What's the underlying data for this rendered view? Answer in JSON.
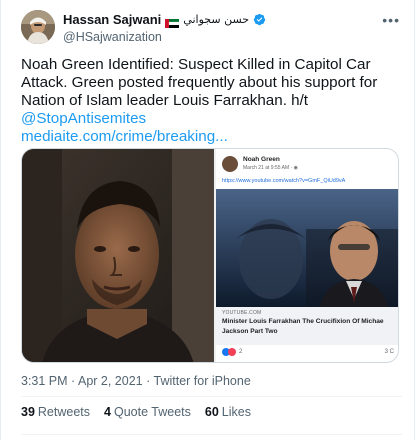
{
  "author": {
    "display_name": "Hassan Sajwani",
    "arabic_name": "حسن سجواني",
    "handle": "@HSajwanization",
    "avatar_icon": "profile-photo",
    "flag_icon": "uae-flag-icon",
    "verified_icon": "verified-badge-icon",
    "verified_color": "#1d9bf0"
  },
  "menu_icon": "more-options-icon",
  "tweet": {
    "text": "Noah Green Identified: Suspect Killed in Capitol Car Attack. Green posted frequently about his support for Nation of Islam leader Louis Farrakhan. h/t",
    "mention": "@StopAntisemites",
    "link": "mediaite.com/crime/breaking..."
  },
  "media": {
    "fb_post": {
      "name": "Noah Green",
      "date": "March 21 at 9:55 AM · ",
      "url": "https://www.youtube.com/watch?v=GmF_QiUd9vA",
      "card_source": "YOUTUBE.COM",
      "card_title_1": "Minister Louis Farrakhan The Crucifixion Of Michae",
      "card_title_2": "Jackson Part Two",
      "reaction_count": "2",
      "comment_count": "3 C"
    }
  },
  "meta": {
    "time": "3:31 PM",
    "separator": " · ",
    "date": "Apr 2, 2021",
    "source": "Twitter for iPhone"
  },
  "stats": {
    "retweets_count": "39",
    "retweets_label": "Retweets",
    "quotes_count": "4",
    "quotes_label": "Quote Tweets",
    "likes_count": "60",
    "likes_label": "Likes"
  },
  "colors": {
    "link": "#1d9bf0",
    "text": "#0f1419",
    "secondary": "#536471",
    "facebook_link": "#216fdb"
  }
}
